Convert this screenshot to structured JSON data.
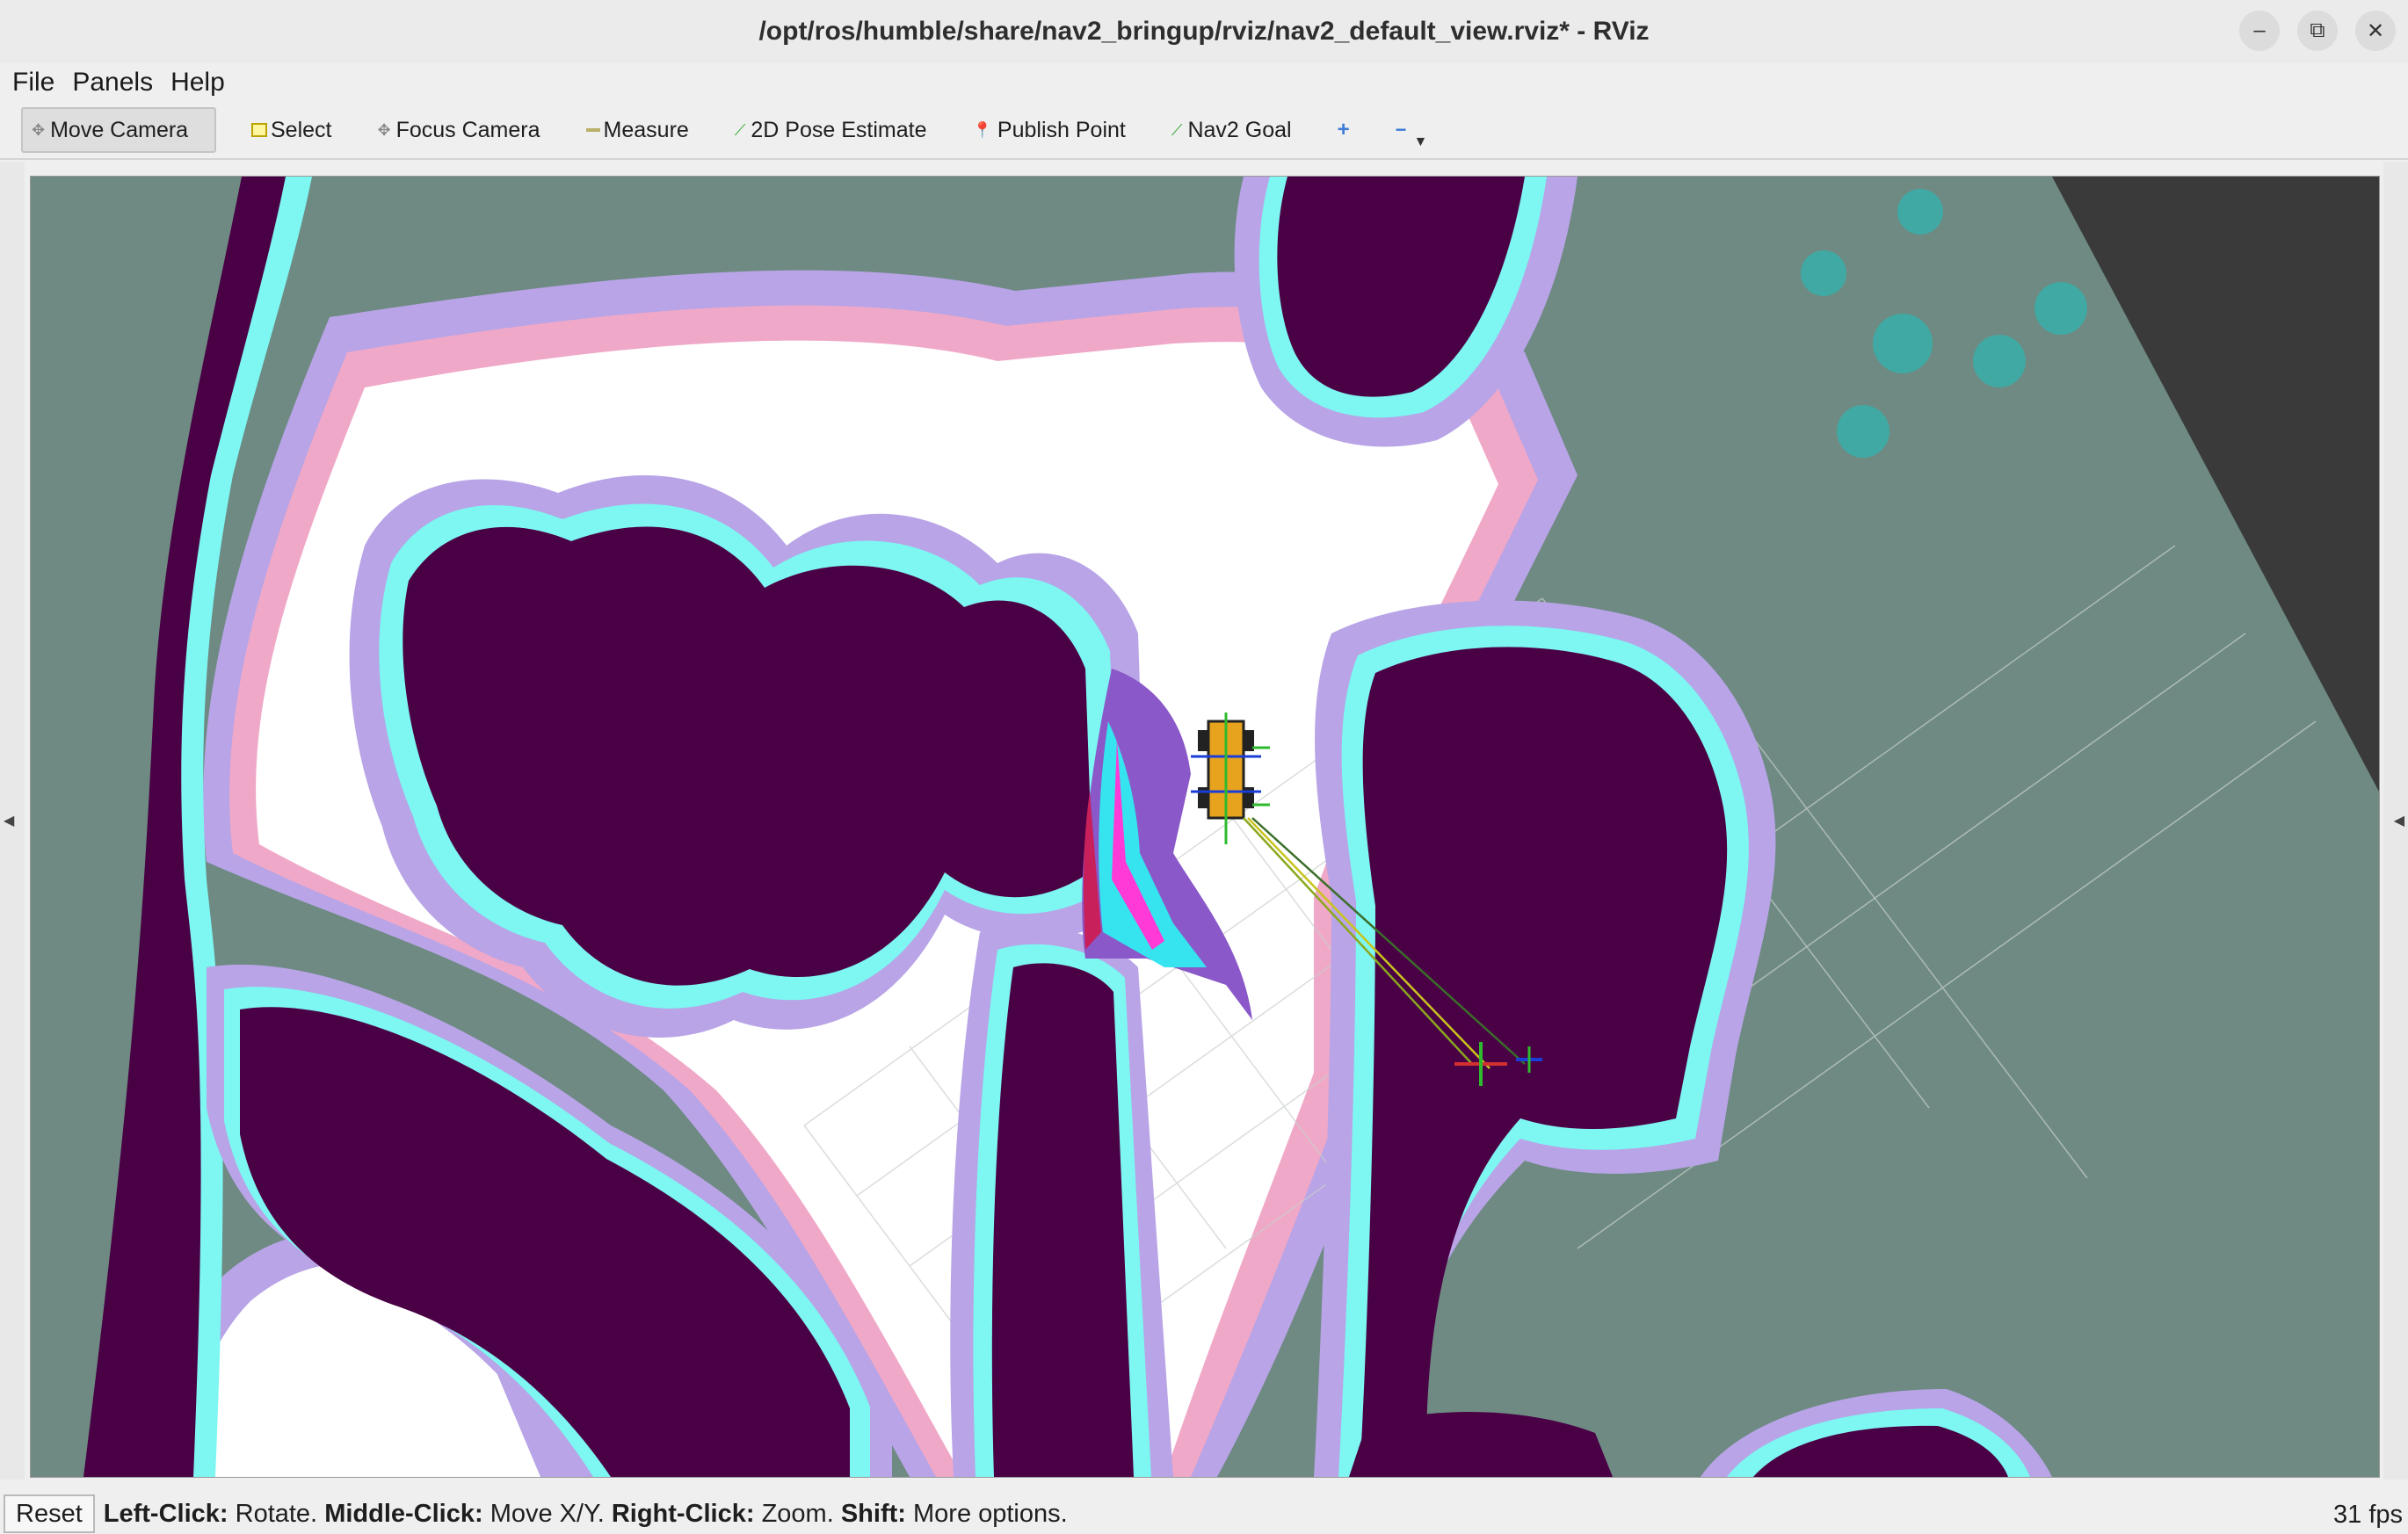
{
  "window": {
    "title": "/opt/ros/humble/share/nav2_bringup/rviz/nav2_default_view.rviz* - RViz",
    "buttons": [
      "–",
      "⧉",
      "✕"
    ]
  },
  "menu": {
    "items": [
      "File",
      "Panels",
      "Help"
    ]
  },
  "toolbar": {
    "tools": [
      {
        "label": "Move Camera",
        "icon": "move-camera-icon",
        "active": true
      },
      {
        "label": "Select",
        "icon": "select-icon"
      },
      {
        "label": "Focus Camera",
        "icon": "focus-camera-icon"
      },
      {
        "label": "Measure",
        "icon": "measure-icon"
      },
      {
        "label": "2D Pose Estimate",
        "icon": "pose-estimate-icon"
      },
      {
        "label": "Publish Point",
        "icon": "publish-point-icon"
      },
      {
        "label": "Nav2 Goal",
        "icon": "nav2-goal-icon"
      }
    ],
    "add_tool": "+",
    "remove_tool": "−"
  },
  "status": {
    "reset_label": "Reset",
    "hint_parts": [
      {
        "key": "Left-Click:",
        "text": " Rotate. "
      },
      {
        "key": "Middle-Click:",
        "text": " Move X/Y. "
      },
      {
        "key": "Right-Click:",
        "text": " Zoom. "
      },
      {
        "key": "Shift:",
        "text": " More options."
      }
    ],
    "fps": "31 fps"
  },
  "colors": {
    "unknown": "#6e8a83",
    "free": "#ffffff",
    "lethal": "#4a0045",
    "inscribed": "#7ef6f2",
    "inflation_high": "#f0a8c8",
    "inflation_low": "#b8a4e6",
    "grid": "#9aa8a2",
    "accent_cost": "#2ecfe0"
  }
}
